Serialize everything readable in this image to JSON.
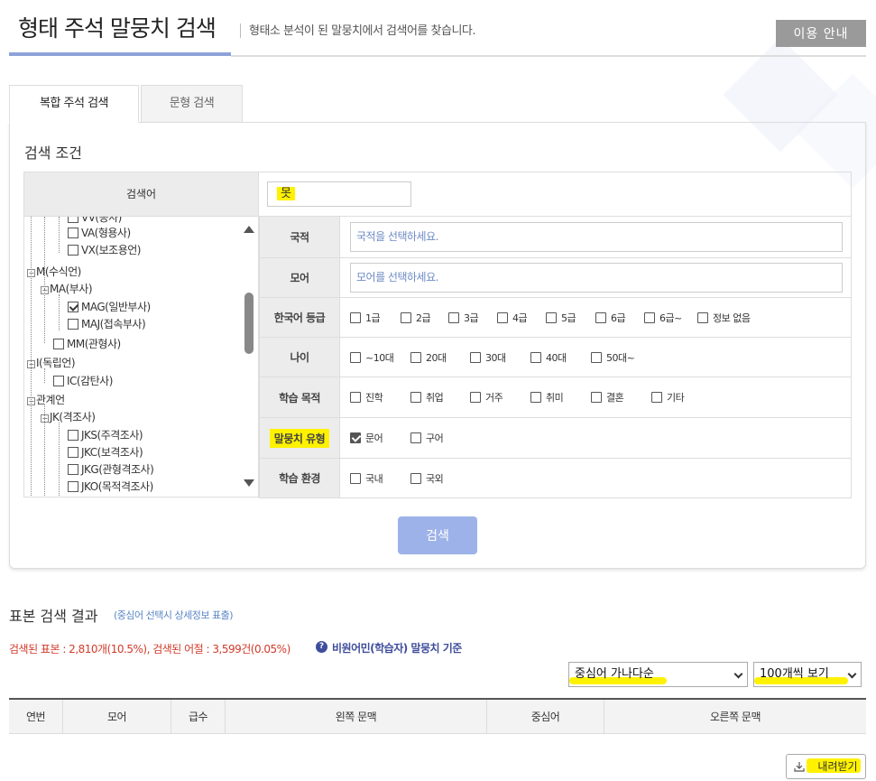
{
  "header": {
    "title": "형태 주석 말뭉치 검색",
    "description": "형태소 분석이 된 말뭉치에서 검색어를 찾습니다.",
    "guide_button": "이용 안내"
  },
  "tabs": [
    {
      "label": "복합 주석 검색",
      "active": true
    },
    {
      "label": "문형 검색",
      "active": false
    }
  ],
  "conditions": {
    "title": "검색 조건",
    "search_term_label": "검색어",
    "search_term_value": "못",
    "tree": [
      {
        "label": "VV(동사)"
      },
      {
        "label": "VA(형용사)",
        "checked": false
      },
      {
        "label": "VX(보조용언)",
        "checked": false
      },
      {
        "label": "M(수식언)"
      },
      {
        "label": "MA(부사)"
      },
      {
        "label": "MAG(일반부사)",
        "checked": true
      },
      {
        "label": "MAJ(접속부사)",
        "checked": false
      },
      {
        "label": "MM(관형사)",
        "checked": false
      },
      {
        "label": "I(독립언)"
      },
      {
        "label": "IC(감탄사)",
        "checked": false
      },
      {
        "label": "관계언"
      },
      {
        "label": "JK(격조사)"
      },
      {
        "label": "JKS(주격조사)",
        "checked": false
      },
      {
        "label": "JKC(보격조사)",
        "checked": false
      },
      {
        "label": "JKG(관형격조사)",
        "checked": false
      },
      {
        "label": "JKO(목적격조사)",
        "checked": false
      }
    ],
    "rows": [
      {
        "label": "국적",
        "placeholder": "국적을 선택하세요."
      },
      {
        "label": "모어",
        "placeholder": "모어를 선택하세요."
      },
      {
        "label": "한국어 등급",
        "options": [
          {
            "label": "1급",
            "checked": false
          },
          {
            "label": "2급",
            "checked": false
          },
          {
            "label": "3급",
            "checked": false
          },
          {
            "label": "4급",
            "checked": false
          },
          {
            "label": "5급",
            "checked": false
          },
          {
            "label": "6급",
            "checked": false
          },
          {
            "label": "6급~",
            "checked": false
          },
          {
            "label": "정보 없음",
            "checked": false
          }
        ]
      },
      {
        "label": "나이",
        "options": [
          {
            "label": "~10대",
            "checked": false
          },
          {
            "label": "20대",
            "checked": false
          },
          {
            "label": "30대",
            "checked": false
          },
          {
            "label": "40대",
            "checked": false
          },
          {
            "label": "50대~",
            "checked": false
          }
        ]
      },
      {
        "label": "학습 목적",
        "options": [
          {
            "label": "진학",
            "checked": false
          },
          {
            "label": "취업",
            "checked": false
          },
          {
            "label": "거주",
            "checked": false
          },
          {
            "label": "취미",
            "checked": false
          },
          {
            "label": "결혼",
            "checked": false
          },
          {
            "label": "기타",
            "checked": false
          }
        ]
      },
      {
        "label": "말뭉치 유형",
        "options": [
          {
            "label": "문어",
            "checked": true
          },
          {
            "label": "구어",
            "checked": false
          }
        ]
      },
      {
        "label": "학습 환경",
        "options": [
          {
            "label": "국내",
            "checked": false
          },
          {
            "label": "국외",
            "checked": false
          }
        ]
      }
    ],
    "search_button": "검색"
  },
  "results": {
    "title": "표본 검색 결과",
    "subtitle": "(중심어 선택시 상세정보 표출)",
    "count_text": "검색된 표본 : 2,810개(10.5%), 검색된 어절 : 3,599건(0.05%)",
    "basis_text": "비원어민(학습자) 말뭉치 기준",
    "sort_select": "중심어 가나다순",
    "page_size_select": "100개씩 보기",
    "columns": [
      "연번",
      "모어",
      "급수",
      "왼쪽 문맥",
      "중심어",
      "오른쪽 문맥"
    ],
    "download_button": "내려받기"
  },
  "colors": {
    "accent": "#8ea2d8",
    "search_button": "#9db2e8",
    "highlight": "#fff200",
    "count_text": "#d23b2a",
    "basis_text": "#3f4e9c"
  }
}
